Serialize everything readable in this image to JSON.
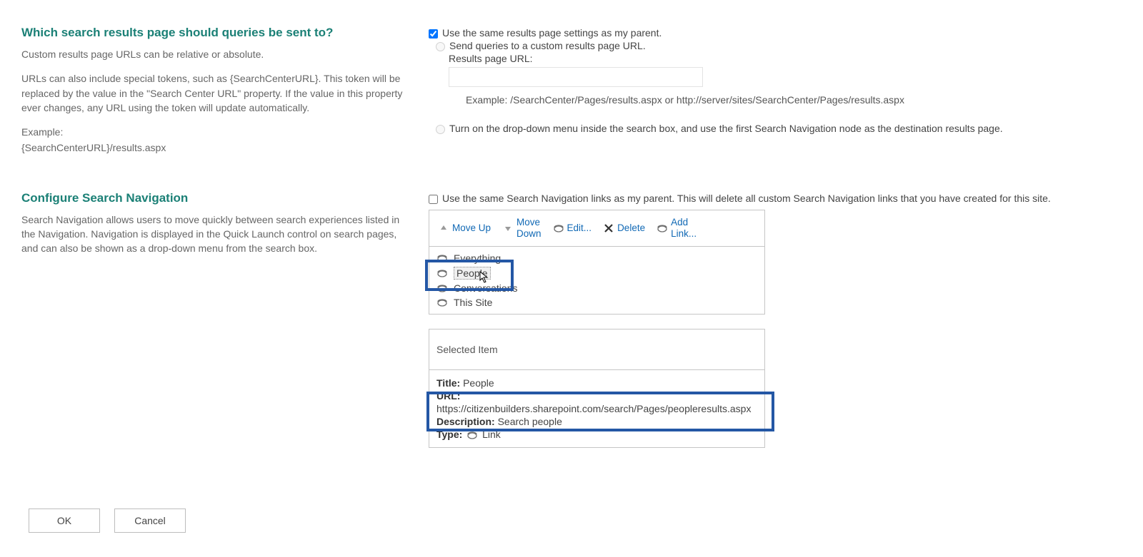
{
  "section1": {
    "title": "Which search results page should queries be sent to?",
    "desc1": "Custom results page URLs can be relative or absolute.",
    "desc2": "URLs can also include special tokens, such as {SearchCenterURL}. This token will be replaced by the value in the \"Search Center URL\" property. If the value in this property ever changes, any URL using the token will update automatically.",
    "desc3a": "Example:",
    "desc3b": "{SearchCenterURL}/results.aspx",
    "opt_same": "Use the same results page settings as my parent.",
    "opt_custom": "Send queries to a custom results page URL.",
    "url_label": "Results page URL:",
    "example": "Example: /SearchCenter/Pages/results.aspx or http://server/sites/SearchCenter/Pages/results.aspx",
    "opt_dropdown": "Turn on the drop-down menu inside the search box, and use the first Search Navigation node as the destination results page."
  },
  "section2": {
    "title": "Configure Search Navigation",
    "desc": "Search Navigation allows users to move quickly between search experiences listed in the Navigation. Navigation is displayed in the Quick Launch control on search pages, and can also be shown as a drop-down menu from the search box.",
    "chk_same": "Use the same Search Navigation links as my parent. This will delete all custom Search Navigation links that you have created for this site."
  },
  "toolbar": {
    "moveup": "Move Up",
    "movedown_a": "Move",
    "movedown_b": "Down",
    "edit": "Edit...",
    "delete": "Delete",
    "addlink_a": "Add",
    "addlink_b": "Link..."
  },
  "nav": {
    "items": [
      {
        "label": "Everything"
      },
      {
        "label": "People"
      },
      {
        "label": "Conversations"
      },
      {
        "label": "This Site"
      }
    ]
  },
  "selected": {
    "header": "Selected Item",
    "title_lbl": "Title:",
    "title_val": "People",
    "url_lbl": "URL:",
    "url_val": "https://citizenbuilders.sharepoint.com/search/Pages/peopleresults.aspx",
    "desc_lbl": "Description:",
    "desc_val": "Search people",
    "type_lbl": "Type:",
    "type_val": "Link"
  },
  "footer": {
    "ok": "OK",
    "cancel": "Cancel"
  }
}
